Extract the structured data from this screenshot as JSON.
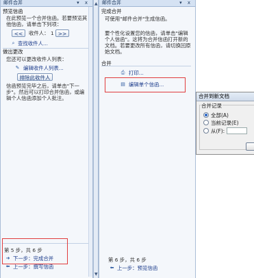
{
  "left_pane": {
    "title": "邮件合并",
    "title_controls": "▾ x",
    "preview_heading": "预览信函",
    "preview_text": "在此预览一个合并信函。若要预览其他信函，请单击下列项：",
    "prev_btn": "<<",
    "recipient_label": "收件人：",
    "recipient_num": "1",
    "next_btn": ">>",
    "find_recipient": "查找收件人...",
    "make_changes_heading": "做出更改",
    "make_changes_text": "您还可以更改收件人列表：",
    "edit_list": "编辑收件人列表...",
    "exclude_btn": "排除此收件人",
    "after_text": "信函预览完毕之后，请单击\"下一步\"。然后可以打印合并信函，或编辑个人信函添加个人批注。",
    "step_text": "第 5 步，共 6 步",
    "next_step": "下一步：完成合并",
    "prev_step": "上一步：撰写信函"
  },
  "right_pane": {
    "title": "邮件合并",
    "title_controls": "▾ x",
    "complete_heading": "完成合并",
    "complete_text": "可使用\"邮件合并\"生成信函。",
    "personalize_text": "要个性化设置您的信函，请单击\"编辑个人信函\"。这将为合并信函打开新的文档。若要更改所有信函，请切换回原始文档。",
    "merge_heading": "合并",
    "print_link": "打印...",
    "edit_individual": "编辑单个信函...",
    "step_text": "第 6 步，共 6 步",
    "prev_step": "上一步：预览信函"
  },
  "dialog": {
    "title": "合并到新文档",
    "group_label": "合并记录",
    "opt_all": "全部(A)",
    "opt_current": "当前记录(E)",
    "opt_from": "从(F):"
  },
  "colors": {
    "highlight": "#e03b3b",
    "link": "#1d3d8c",
    "pane_bg": "#f4f7fb"
  }
}
